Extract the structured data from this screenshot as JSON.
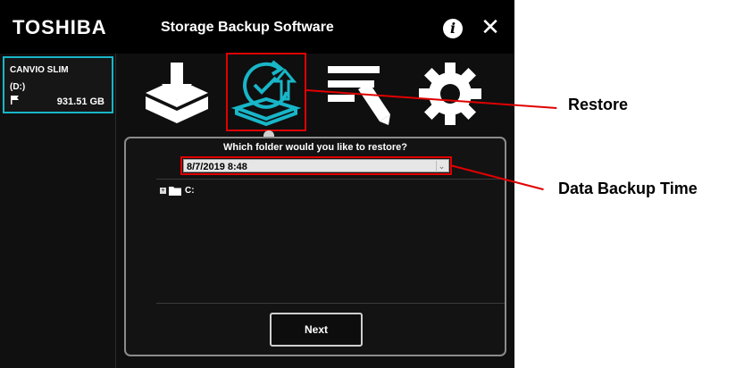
{
  "window": {
    "brand": "TOSHIBA",
    "title": "Storage Backup Software",
    "info_icon": "info-icon",
    "close_label": "✕"
  },
  "sidebar": {
    "drive": {
      "name": "CANVIO SLIM",
      "letter": "(D:)",
      "flag_icon": "flag-icon",
      "size": "931.51 GB"
    }
  },
  "toolbar": {
    "items": [
      {
        "name": "backup",
        "icon": "download-tray-icon"
      },
      {
        "name": "restore",
        "icon": "restore-icon",
        "selected": true
      },
      {
        "name": "manage",
        "icon": "list-pen-icon"
      },
      {
        "name": "settings",
        "icon": "gear-icon"
      }
    ]
  },
  "restore": {
    "question": "Which folder would you like to restore?",
    "selected_time": "8/7/2019 8:48",
    "tree": [
      {
        "toggle": "+",
        "icon": "folder-icon",
        "label": "C:"
      }
    ],
    "next_label": "Next"
  },
  "annotations": {
    "restore_label": "Restore",
    "backup_time_label": "Data Backup Time",
    "color": "#e00000"
  },
  "colors": {
    "accent": "#18b6c8",
    "highlight": "#e00000",
    "background": "#0f0f0f"
  }
}
